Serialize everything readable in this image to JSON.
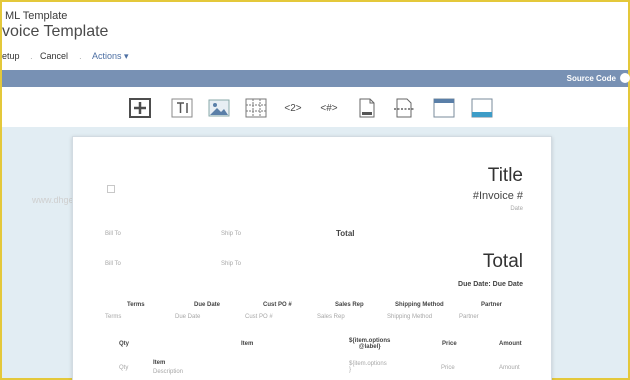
{
  "header": {
    "kicker": "ML Template",
    "title": "voice Template"
  },
  "toolbar": {
    "setup_label": "etup",
    "cancel_label": "Cancel",
    "actions_label": "Actions ▾",
    "separator": "·"
  },
  "bluebar": {
    "source_code_label": "Source Code"
  },
  "insert_bar": {
    "items": [
      {
        "icon": "add-icon"
      },
      {
        "icon": "text-field-icon",
        "glyph": "T|"
      },
      {
        "icon": "image-icon"
      },
      {
        "icon": "table-grid-icon"
      },
      {
        "icon": "field-tag-icon",
        "glyph": "<2>"
      },
      {
        "icon": "code-tag-icon",
        "glyph": "<#>"
      },
      {
        "icon": "page-footer-icon"
      },
      {
        "icon": "page-break-icon"
      },
      {
        "icon": "header-band-icon"
      },
      {
        "icon": "footer-band-icon"
      }
    ]
  },
  "invoice": {
    "title": "Title",
    "invoice_number": "#Invoice #",
    "date": "Date",
    "bill_to_1": "Bill To",
    "ship_to_1": "Ship To",
    "total_small": "Total",
    "bill_to_2": "Bill To",
    "ship_to_2": "Ship To",
    "total_large": "Total",
    "due_date": "Due Date: Due Date",
    "terms_headers": [
      "Terms",
      "Due Date",
      "Cust PO #",
      "Sales Rep",
      "Shipping Method",
      "Partner"
    ],
    "terms_values": [
      "Terms",
      "Due Date",
      "Cust PO #",
      "Sales Rep",
      "Shipping Method",
      "Partner"
    ],
    "item_headers": {
      "qty": "Qty",
      "item": "Item",
      "options_line1": "${item.options",
      "options_line2": "@label}",
      "price": "Price",
      "amount": "Amount"
    },
    "item_row": {
      "qty": "Qty",
      "item": "Item",
      "description": "Description",
      "options_line1": "${item.options",
      "options_line2": "}",
      "price": "Price",
      "amount": "Amount"
    }
  },
  "watermark": "www.dhgetpvtcr.ch.eetrvidiipu.com",
  "colors": {
    "frame": "#e4c83a",
    "bluebar": "#7891b4",
    "canvas": "#e2edf3",
    "actions_link": "#4d6fa3"
  }
}
